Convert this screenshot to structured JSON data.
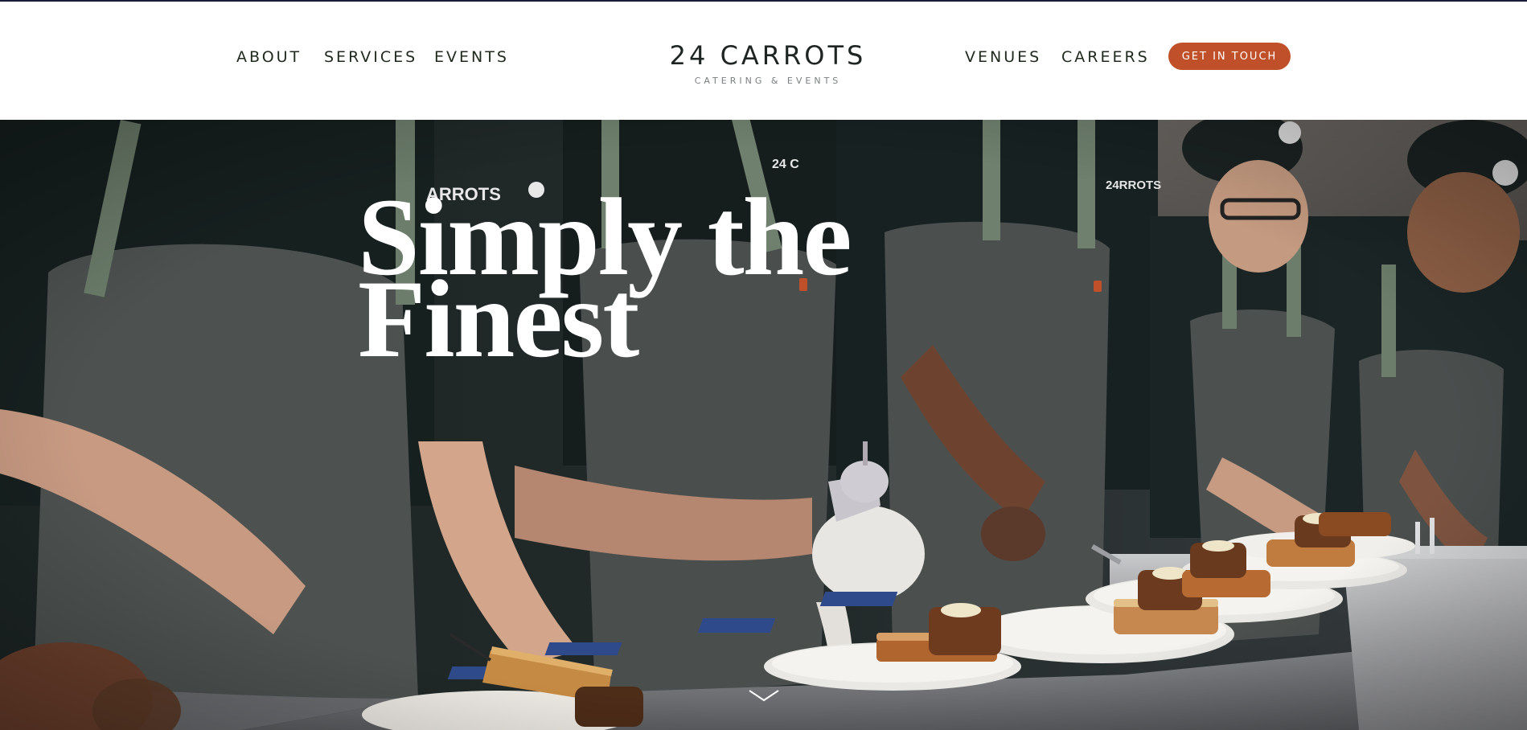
{
  "header": {
    "nav_left": [
      "ABOUT",
      "SERVICES",
      "EVENTS"
    ],
    "nav_right": [
      "VENUES",
      "CAREERS"
    ],
    "cta_label": "GET IN TOUCH",
    "brand_name": "24 CARROTS",
    "brand_tagline": "CATERING & EVENTS"
  },
  "hero": {
    "title_line1": "Simply the",
    "title_line2": "Finest",
    "background": "photo of chefs in dark uniforms and grey aprons plating desserts on white plates at a steel counter",
    "scroll_icon": "chevron-down-icon"
  },
  "colors": {
    "accent": "#c0502a",
    "nav_text": "#1f2a1d",
    "header_bg": "#ffffff",
    "hero_title": "#ffffff"
  }
}
